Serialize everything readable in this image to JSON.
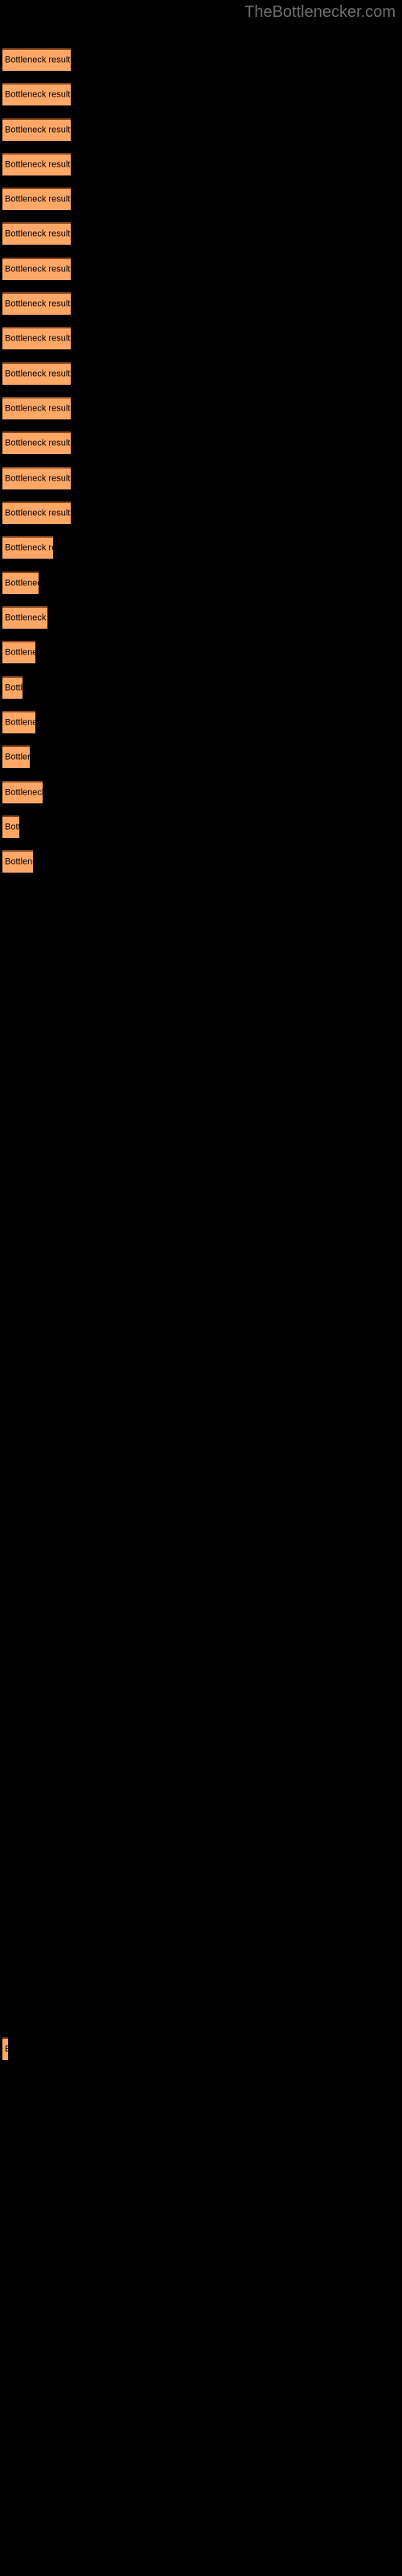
{
  "site": {
    "title": "TheBottlenecker.com",
    "title_color": "#6e6e6e",
    "background_color": "#000000"
  },
  "chart_data": {
    "type": "bar",
    "orientation": "horizontal",
    "title": "TheBottlenecker.com",
    "xlabel": "",
    "ylabel": "",
    "grid": false,
    "legend": null,
    "bar_color": "#ffa766",
    "bar_edge_color": "#8a4a21",
    "label_color": "#000000",
    "background_color": "#000000",
    "bar_label": "Bottleneck result",
    "categories": [
      "Bottleneck result",
      "Bottleneck result",
      "Bottleneck result",
      "Bottleneck result",
      "Bottleneck result",
      "Bottleneck result",
      "Bottleneck result",
      "Bottleneck result",
      "Bottleneck result",
      "Bottleneck result",
      "Bottleneck result",
      "Bottleneck result",
      "Bottleneck result",
      "Bottleneck result",
      "Bottleneck result",
      "Bottleneck result",
      "Bottleneck result",
      "Bottleneck result",
      "Bottleneck result",
      "Bottleneck result",
      "Bottleneck result",
      "Bottleneck result",
      "Bottleneck result",
      "Bottleneck result",
      "Bottleneck result"
    ],
    "values": [
      85,
      85,
      85,
      85,
      85,
      85,
      85,
      85,
      85,
      85,
      85,
      85,
      85,
      85,
      63,
      45,
      56,
      41,
      25,
      41,
      34,
      50,
      21,
      38,
      7
    ],
    "xlim": [
      0,
      500
    ],
    "bars": [
      {
        "y": 60,
        "width": 85,
        "label": "Bottleneck result"
      },
      {
        "y": 103,
        "width": 85,
        "label": "Bottleneck result"
      },
      {
        "y": 147,
        "width": 85,
        "label": "Bottleneck result"
      },
      {
        "y": 190,
        "width": 85,
        "label": "Bottleneck result"
      },
      {
        "y": 233,
        "width": 85,
        "label": "Bottleneck result"
      },
      {
        "y": 276,
        "width": 85,
        "label": "Bottleneck result"
      },
      {
        "y": 320,
        "width": 85,
        "label": "Bottleneck result"
      },
      {
        "y": 363,
        "width": 85,
        "label": "Bottleneck result"
      },
      {
        "y": 406,
        "width": 85,
        "label": "Bottleneck result"
      },
      {
        "y": 450,
        "width": 85,
        "label": "Bottleneck result"
      },
      {
        "y": 493,
        "width": 85,
        "label": "Bottleneck result"
      },
      {
        "y": 536,
        "width": 85,
        "label": "Bottleneck result"
      },
      {
        "y": 580,
        "width": 85,
        "label": "Bottleneck result"
      },
      {
        "y": 623,
        "width": 85,
        "label": "Bottleneck result"
      },
      {
        "y": 666,
        "width": 63,
        "label": "Bottleneck result"
      },
      {
        "y": 710,
        "width": 45,
        "label": "Bottleneck result"
      },
      {
        "y": 753,
        "width": 56,
        "label": "Bottleneck result"
      },
      {
        "y": 796,
        "width": 41,
        "label": "Bottleneck result"
      },
      {
        "y": 840,
        "width": 25,
        "label": "Bottleneck result"
      },
      {
        "y": 883,
        "width": 41,
        "label": "Bottleneck result"
      },
      {
        "y": 926,
        "width": 34,
        "label": "Bottleneck result"
      },
      {
        "y": 970,
        "width": 50,
        "label": "Bottleneck result"
      },
      {
        "y": 1013,
        "width": 21,
        "label": "Bottleneck result"
      },
      {
        "y": 1056,
        "width": 38,
        "label": "Bottleneck result"
      },
      {
        "y": 2531,
        "width": 7,
        "label": "Bottleneck result"
      }
    ]
  }
}
